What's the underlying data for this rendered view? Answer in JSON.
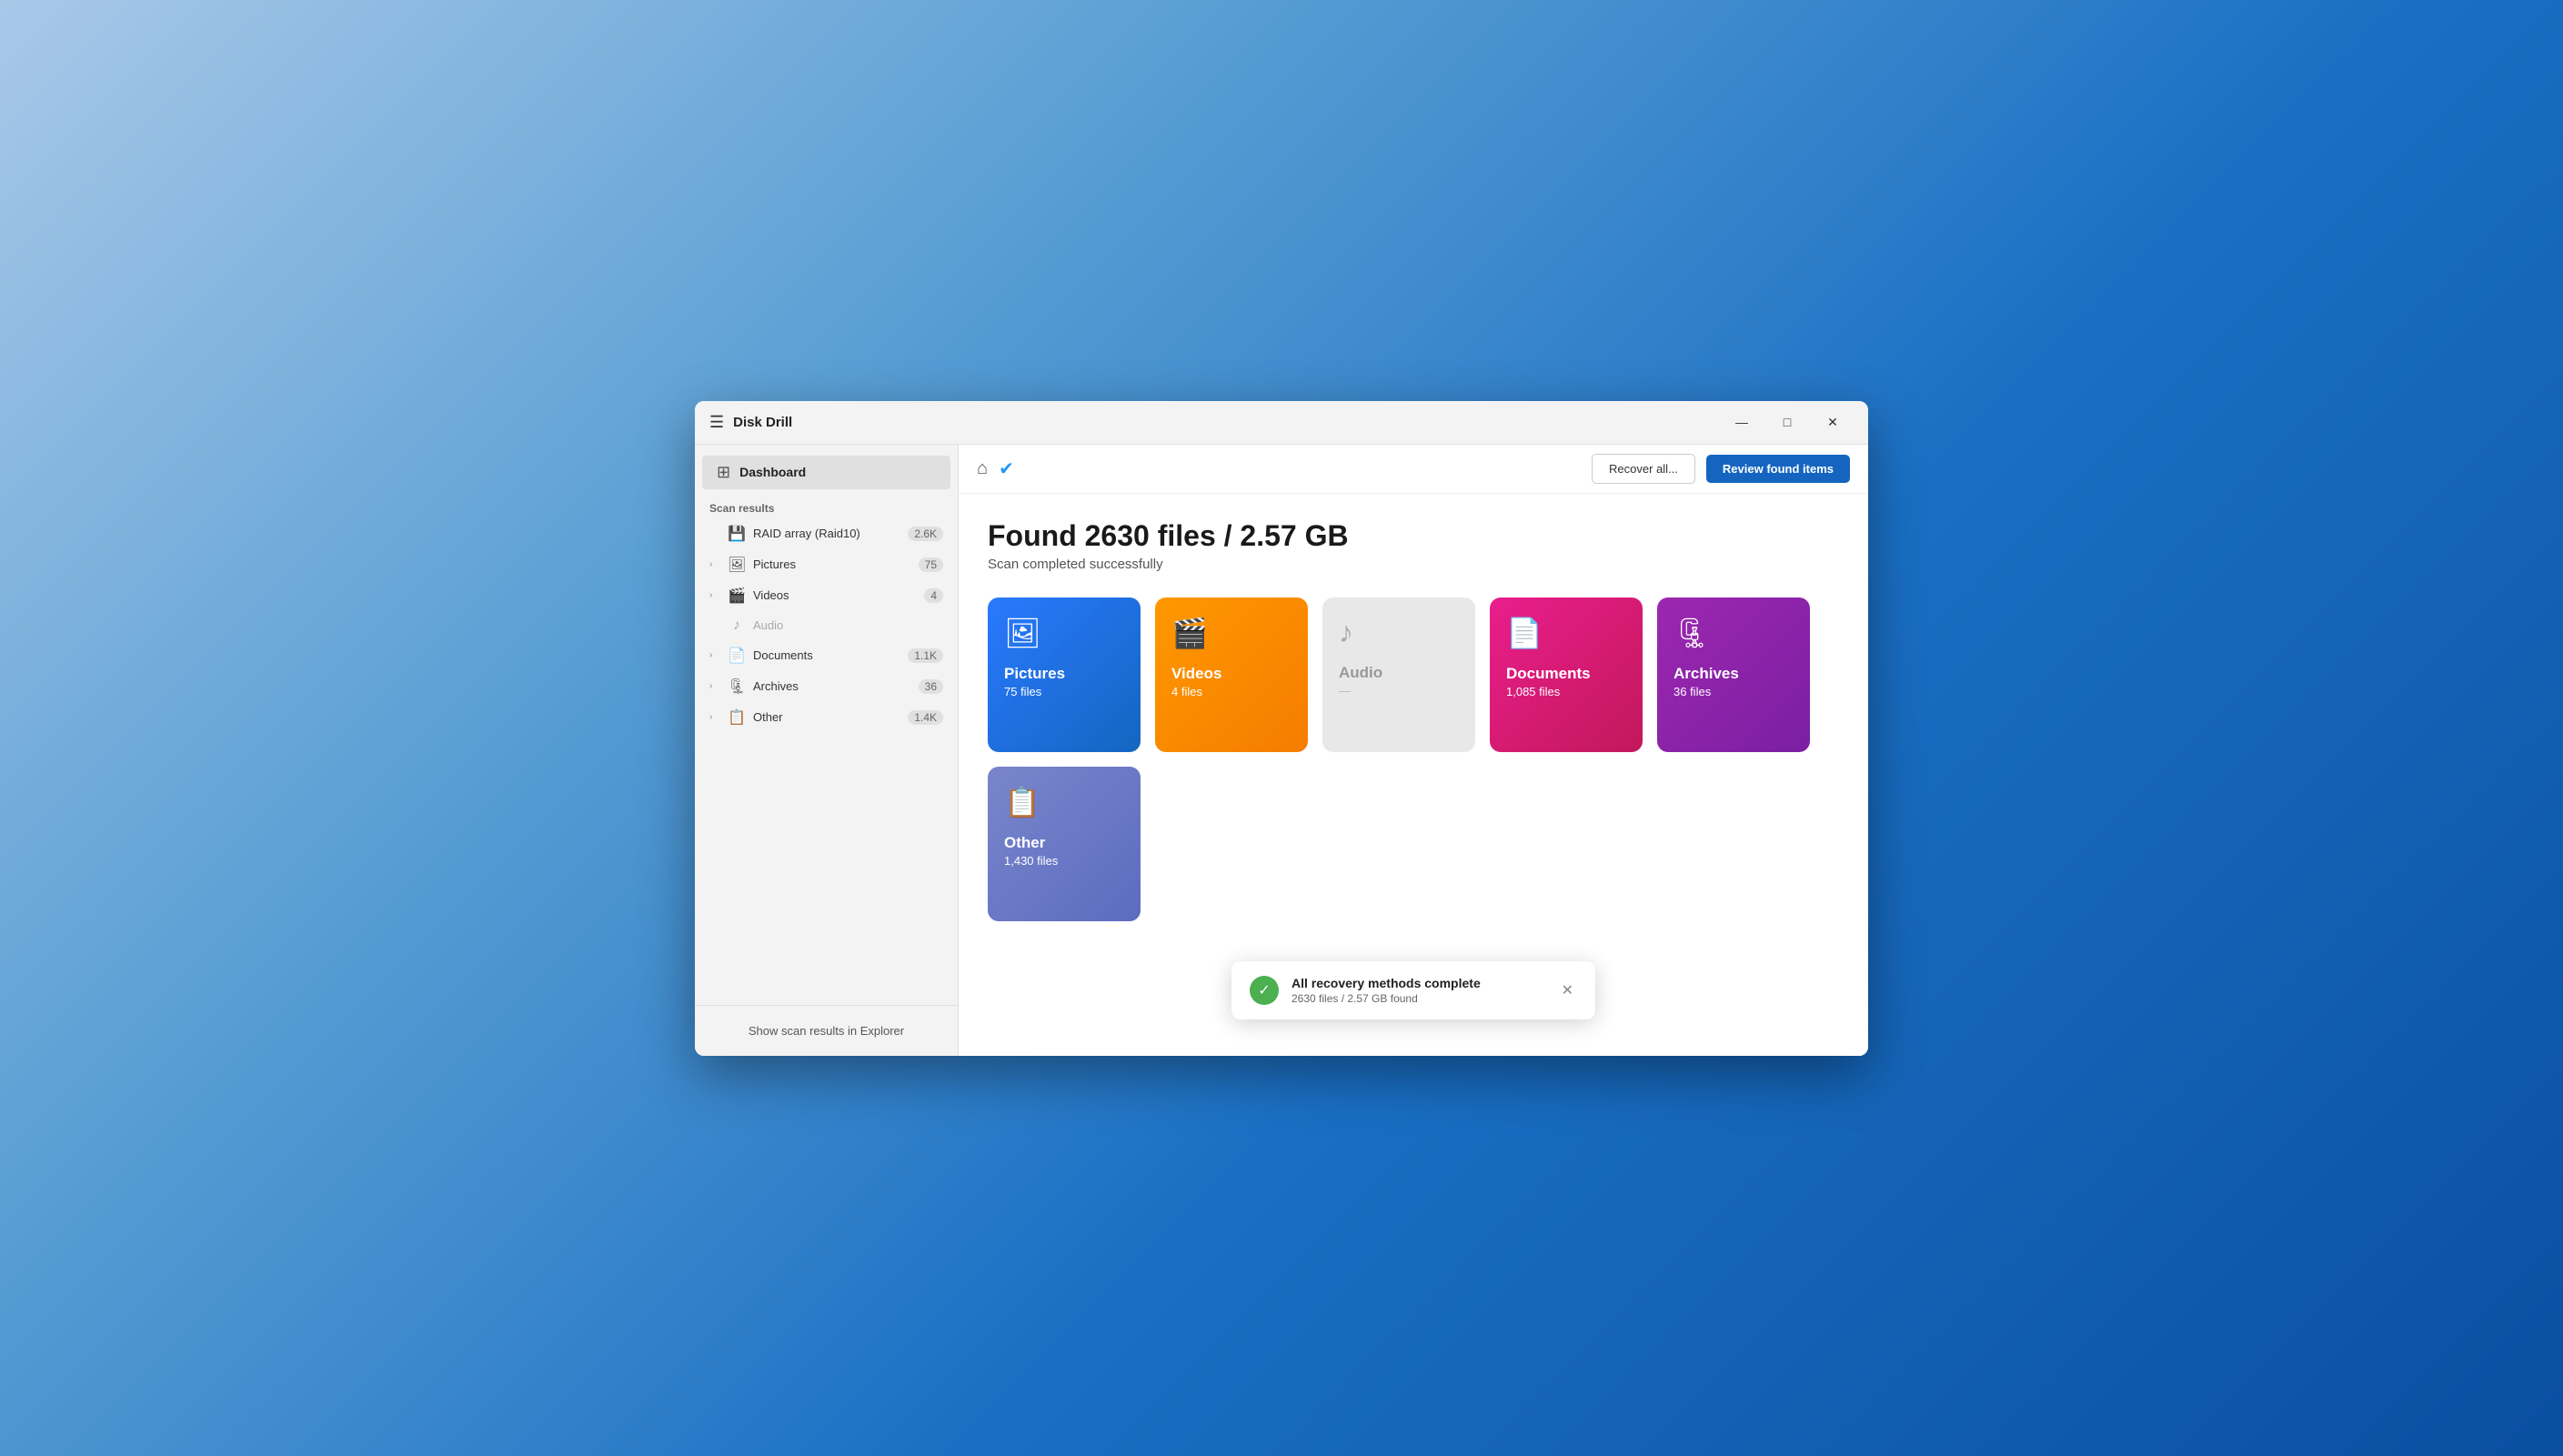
{
  "titlebar": {
    "menu_label": "☰",
    "title": "Disk Drill",
    "minimize_label": "—",
    "maximize_label": "□",
    "close_label": "✕"
  },
  "sidebar": {
    "dashboard_label": "Dashboard",
    "scan_results_label": "Scan results",
    "items": [
      {
        "id": "raid",
        "label": "RAID array (Raid10)",
        "count": "2.6K",
        "has_chevron": false,
        "icon": "💾"
      },
      {
        "id": "pictures",
        "label": "Pictures",
        "count": "75",
        "has_chevron": true,
        "icon": "🖼"
      },
      {
        "id": "videos",
        "label": "Videos",
        "count": "4",
        "has_chevron": true,
        "icon": "🎬"
      },
      {
        "id": "audio",
        "label": "Audio",
        "count": "",
        "has_chevron": false,
        "icon": "♪",
        "disabled": true
      },
      {
        "id": "documents",
        "label": "Documents",
        "count": "1.1K",
        "has_chevron": true,
        "icon": "📄"
      },
      {
        "id": "archives",
        "label": "Archives",
        "count": "36",
        "has_chevron": true,
        "icon": "🗜"
      },
      {
        "id": "other",
        "label": "Other",
        "count": "1.4K",
        "has_chevron": true,
        "icon": "📋"
      }
    ],
    "footer_btn": "Show scan results in Explorer"
  },
  "toolbar": {
    "recover_label": "Recover all...",
    "review_label": "Review found items"
  },
  "main": {
    "found_title": "Found 2630 files / 2.57 GB",
    "scan_status": "Scan completed successfully",
    "cards": [
      {
        "id": "pictures",
        "name": "Pictures",
        "count": "75 files",
        "icon": "🖼",
        "style": "pictures"
      },
      {
        "id": "videos",
        "name": "Videos",
        "count": "4 files",
        "icon": "🎬",
        "style": "videos"
      },
      {
        "id": "audio",
        "name": "Audio",
        "count": "—",
        "icon": "♪",
        "style": "audio"
      },
      {
        "id": "documents",
        "name": "Documents",
        "count": "1,085 files",
        "icon": "📄",
        "style": "documents"
      },
      {
        "id": "archives",
        "name": "Archives",
        "count": "36 files",
        "icon": "🗜",
        "style": "archives"
      },
      {
        "id": "other",
        "name": "Other",
        "count": "1,430 files",
        "icon": "📋",
        "style": "other"
      }
    ]
  },
  "toast": {
    "title": "All recovery methods complete",
    "subtitle": "2630 files / 2.57 GB found"
  }
}
